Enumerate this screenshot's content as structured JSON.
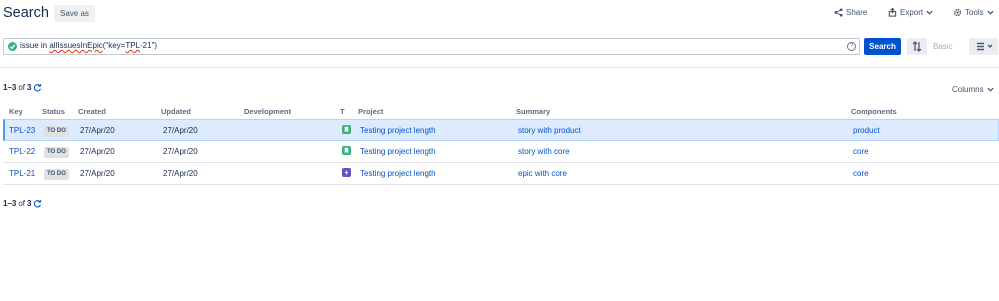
{
  "header": {
    "title": "Search",
    "save_as_label": "Save as",
    "share_label": "Share",
    "export_label": "Export",
    "tools_label": "Tools"
  },
  "query": {
    "prefix": "issue in ",
    "function_name": "allIssuesInEpic",
    "suffix_a": "(\"key=",
    "key": "TPL",
    "suffix_b": "-21\")",
    "help_label": "?",
    "search_label": "Search",
    "basic_label": "Basic"
  },
  "results": {
    "range_label": "1–3",
    "of_label": "of",
    "total": "3",
    "columns_label": "Columns"
  },
  "table": {
    "headers": [
      "Key",
      "Status",
      "Created",
      "Updated",
      "Development",
      "T",
      "Project",
      "Summary",
      "Components"
    ],
    "rows": [
      {
        "key": "TPL-23",
        "status": "TO DO",
        "created": "27/Apr/20",
        "updated": "27/Apr/20",
        "type_icon": "story-icon",
        "project": "Testing project length",
        "summary": "story with product",
        "component": "product"
      },
      {
        "key": "TPL-22",
        "status": "TO DO",
        "created": "27/Apr/20",
        "updated": "27/Apr/20",
        "type_icon": "story-icon",
        "project": "Testing project length",
        "summary": "story with core",
        "component": "core"
      },
      {
        "key": "TPL-21",
        "status": "TO DO",
        "created": "27/Apr/20",
        "updated": "27/Apr/20",
        "type_icon": "epic-icon",
        "project": "Testing project length",
        "summary": "epic with core",
        "component": "core"
      }
    ]
  },
  "colors": {
    "primary": "#0052cc",
    "story": "#36b37e",
    "epic": "#6554c0",
    "selected_row": "#deebff"
  }
}
